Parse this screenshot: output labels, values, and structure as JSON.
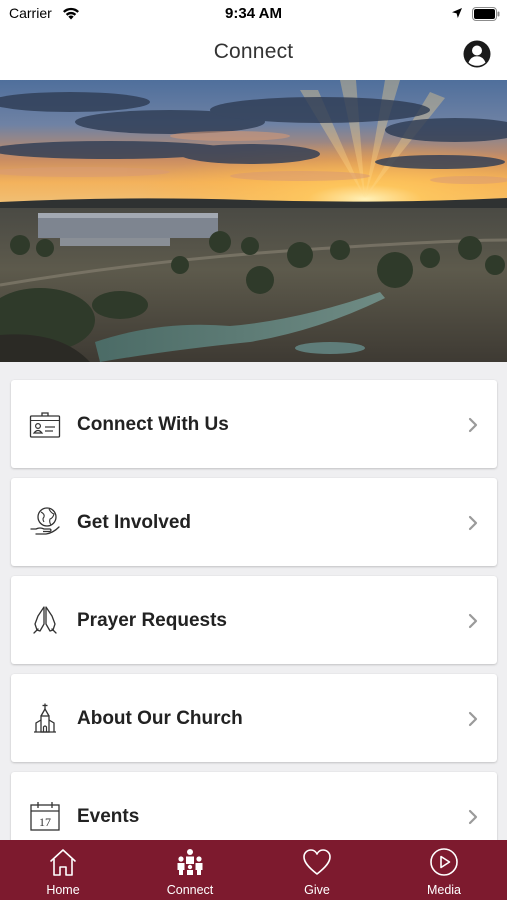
{
  "status_bar": {
    "carrier": "Carrier",
    "time": "9:34 AM"
  },
  "nav": {
    "title": "Connect"
  },
  "menu": {
    "items": [
      {
        "label": "Connect With Us",
        "icon": "id-card-icon"
      },
      {
        "label": "Get Involved",
        "icon": "globe-in-hand-icon"
      },
      {
        "label": "Prayer Requests",
        "icon": "praying-hands-icon"
      },
      {
        "label": "About Our Church",
        "icon": "church-icon"
      },
      {
        "label": "Events",
        "icon": "calendar-icon",
        "calendar_day": "17"
      }
    ]
  },
  "tab_bar": {
    "tabs": [
      {
        "label": "Home",
        "icon": "home-icon"
      },
      {
        "label": "Connect",
        "icon": "people-icon"
      },
      {
        "label": "Give",
        "icon": "heart-icon"
      },
      {
        "label": "Media",
        "icon": "play-icon"
      }
    ],
    "background": "#7d1a2e",
    "foreground": "#ffffff"
  }
}
